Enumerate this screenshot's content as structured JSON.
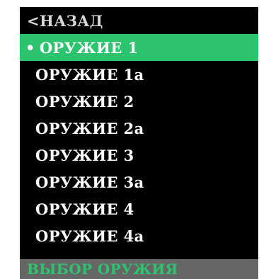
{
  "menu": {
    "back_label": "<НАЗАД",
    "selected_marker": "•",
    "items": [
      {
        "label": "ОРУЖИЕ 1",
        "selected": true
      },
      {
        "label": "ОРУЖИЕ 1a",
        "selected": false
      },
      {
        "label": "ОРУЖИЕ 2",
        "selected": false
      },
      {
        "label": "ОРУЖИЕ 2a",
        "selected": false
      },
      {
        "label": "ОРУЖИЕ 3",
        "selected": false
      },
      {
        "label": "ОРУЖИЕ 3a",
        "selected": false
      },
      {
        "label": "ОРУЖИЕ 4",
        "selected": false
      },
      {
        "label": "ОРУЖИЕ 4a",
        "selected": false
      }
    ],
    "footer_label": "ВЫБОР ОРУЖИЯ"
  },
  "colors": {
    "background": "#000000",
    "highlight": "#2cc56e",
    "footer_background": "#666666",
    "text": "#ffffff"
  }
}
